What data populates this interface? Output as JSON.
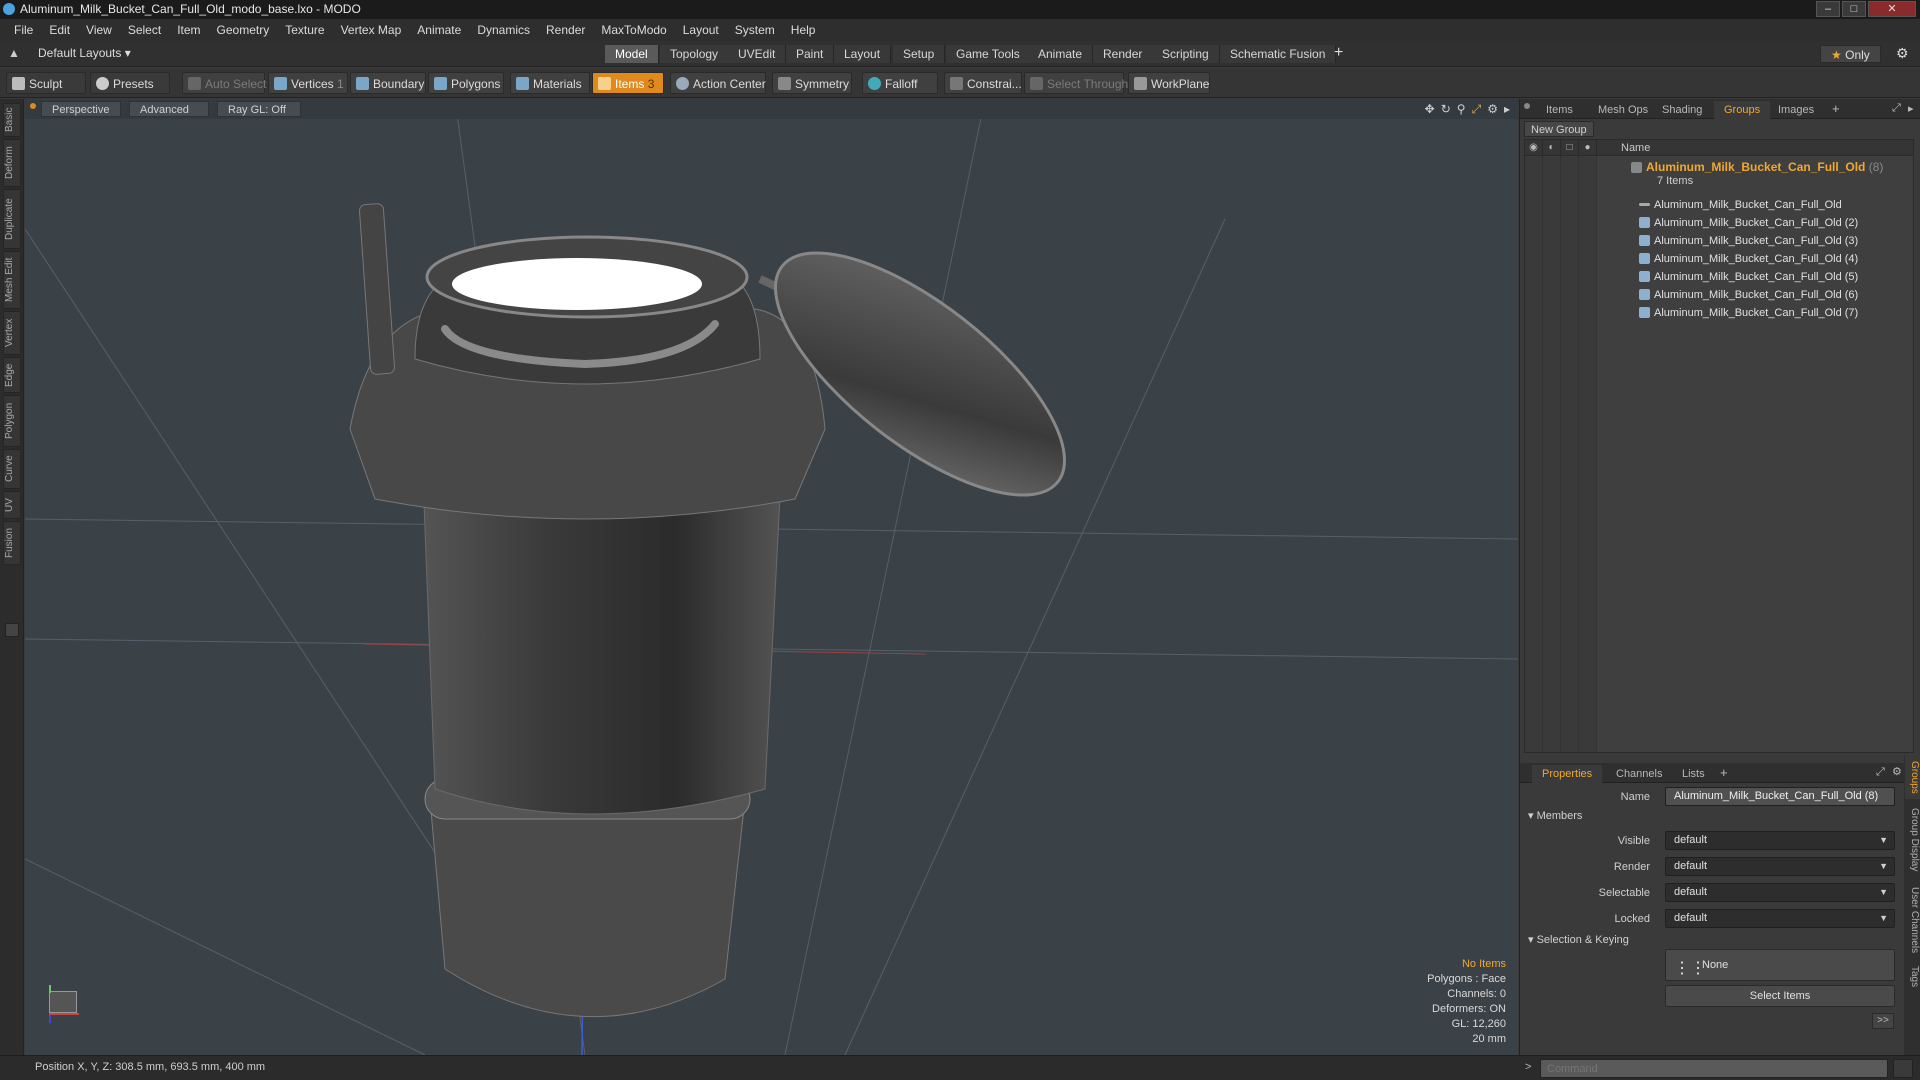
{
  "window": {
    "title": "Aluminum_Milk_Bucket_Can_Full_Old_modo_base.lxo - MODO"
  },
  "menu": [
    "File",
    "Edit",
    "View",
    "Select",
    "Item",
    "Geometry",
    "Texture",
    "Vertex Map",
    "Animate",
    "Dynamics",
    "Render",
    "MaxToModo",
    "Layout",
    "System",
    "Help"
  ],
  "layoutbar": {
    "layouts_label": "Default Layouts",
    "tabs": [
      "Model",
      "Topology",
      "UVEdit",
      "Paint",
      "Layout",
      "Setup",
      "Game Tools",
      "Animate",
      "Render",
      "Scripting",
      "Schematic Fusion"
    ],
    "active_tab": "Model",
    "add": "+",
    "only": "Only"
  },
  "toolbar": {
    "sculpt": "Sculpt",
    "presets": "Presets",
    "auto_select": "Auto Select",
    "vertices": "Vertices",
    "vertices_count": "1",
    "boundary": "Boundary",
    "polygons": "Polygons",
    "materials": "Materials",
    "items": "Items",
    "items_count": "3",
    "action_center": "Action Center",
    "symmetry": "Symmetry",
    "falloff": "Falloff",
    "constraints": "Constrai...",
    "select_through": "Select Through",
    "workplane": "WorkPlane"
  },
  "left_tabs": [
    "Basic",
    "Deform",
    "Duplicate",
    "Mesh Edit",
    "Vertex",
    "Edge",
    "Polygon",
    "Curve",
    "UV",
    "Fusion"
  ],
  "viewport": {
    "view": "Perspective",
    "shading": "Advanced",
    "raygl": "Ray GL: Off",
    "info": {
      "selection": "No Items",
      "polygons": "Polygons : Face",
      "channels": "Channels: 0",
      "deformers": "Deformers: ON",
      "gl": "GL: 12,260",
      "scale": "20 mm"
    }
  },
  "statusbar": {
    "position": "Position X, Y, Z:   308.5 mm, 693.5 mm, 400 mm",
    "command_label": ">",
    "command_placeholder": "Command"
  },
  "panel_tabs": [
    "Items",
    "Mesh Ops",
    "Shading",
    "Groups",
    "Images"
  ],
  "panel_active": "Groups",
  "groups": {
    "new_group": "New Group",
    "name_header": "Name",
    "group_name": "Aluminum_Milk_Bucket_Can_Full_Old",
    "group_count": "(8)",
    "group_sub": "7 Items",
    "items": [
      "Aluminum_Milk_Bucket_Can_Full_Old",
      "Aluminum_Milk_Bucket_Can_Full_Old (2)",
      "Aluminum_Milk_Bucket_Can_Full_Old (3)",
      "Aluminum_Milk_Bucket_Can_Full_Old (4)",
      "Aluminum_Milk_Bucket_Can_Full_Old (5)",
      "Aluminum_Milk_Bucket_Can_Full_Old (6)",
      "Aluminum_Milk_Bucket_Can_Full_Old (7)"
    ]
  },
  "props_tabs": [
    "Properties",
    "Channels",
    "Lists"
  ],
  "props_active": "Properties",
  "properties": {
    "name_label": "Name",
    "name_value": "Aluminum_Milk_Bucket_Can_Full_Old (8)",
    "members_section": "Members",
    "visible_label": "Visible",
    "visible_value": "default",
    "render_label": "Render",
    "render_value": "default",
    "selectable_label": "Selectable",
    "selectable_value": "default",
    "locked_label": "Locked",
    "locked_value": "default",
    "keying_section": "Selection & Keying",
    "none_label": "None",
    "select_items": "Select Items",
    "more": ">>"
  },
  "side_tabs": [
    "Groups",
    "Group Display",
    "User Channels",
    "Tags"
  ],
  "colors": {
    "accent": "#f0a830",
    "active_tool": "#e08a1e",
    "viewport_bg": "#3b4247"
  }
}
